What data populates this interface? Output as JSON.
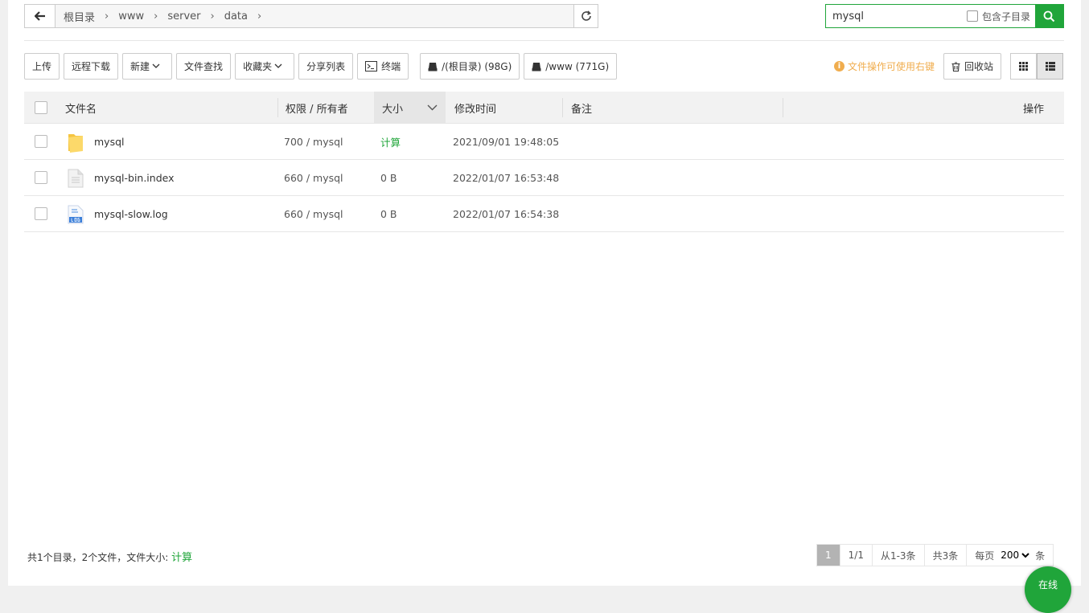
{
  "path": {
    "crumbs": [
      "根目录",
      "www",
      "server",
      "data"
    ]
  },
  "search": {
    "value": "mysql",
    "subdir_label": "包含子目录"
  },
  "toolbar": {
    "upload": "上传",
    "remote_download": "远程下载",
    "new": "新建",
    "file_search": "文件查找",
    "favorites": "收藏夹",
    "share_list": "分享列表",
    "terminal": "终端",
    "disk_root": "/(根目录) (98G)",
    "disk_www": "/www (771G)",
    "tip": "文件操作可使用右键",
    "recycle": "回收站"
  },
  "table": {
    "headers": {
      "name": "文件名",
      "perm": "权限 / 所有者",
      "size": "大小",
      "mtime": "修改时间",
      "note": "备注",
      "ops": "操作"
    },
    "rows": [
      {
        "name": "mysql",
        "type": "folder",
        "perm": "700 / mysql",
        "size": "计算",
        "mtime": "2021/09/01 19:48:05"
      },
      {
        "name": "mysql-bin.index",
        "type": "file",
        "perm": "660 / mysql",
        "size": "0 B",
        "mtime": "2022/01/07 16:53:48"
      },
      {
        "name": "mysql-slow.log",
        "type": "log",
        "perm": "660 / mysql",
        "size": "0 B",
        "mtime": "2022/01/07 16:54:38"
      }
    ]
  },
  "footer": {
    "summary": "共1个目录，2个文件，文件大小:",
    "calc": "计算",
    "page_current": "1",
    "page_total": "1/1",
    "range": "从1-3条",
    "total": "共3条",
    "per_page_label": "每页",
    "per_page_value": "200",
    "per_page_unit": "条"
  },
  "online_label": "在线",
  "colors": {
    "accent": "#20a53a",
    "tip": "#f0ad4e"
  }
}
